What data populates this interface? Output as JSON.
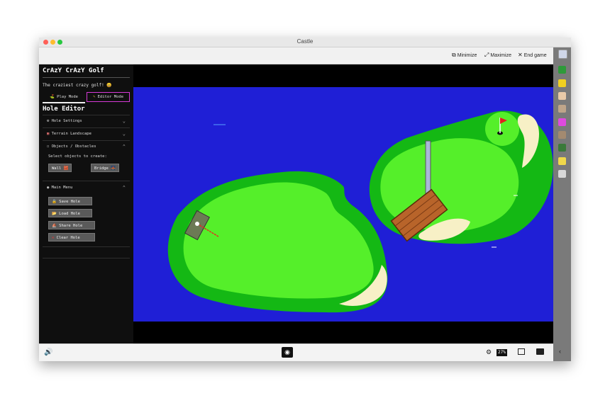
{
  "window": {
    "title": "Castle",
    "toolbar": {
      "minimize": "Minimize",
      "maximize": "Maximize",
      "end_game": "End game"
    }
  },
  "sidebar": {
    "game_title": "CrAzY CrAzY Golf",
    "subtitle": "The craziest crazy golf! 😀",
    "modes": {
      "play": "Play Mode",
      "editor": "Editor Mode",
      "active": "editor"
    },
    "section_title": "Hole Editor",
    "sections": [
      {
        "label": "Hole Settings",
        "icon": "gear-icon"
      },
      {
        "label": "Terrain Landscape",
        "icon": "terrain-icon"
      },
      {
        "label": "Objects / Obstacles",
        "icon": "square-icon"
      }
    ],
    "objects_hint": "Select objects to create:",
    "objects": {
      "wall": "Wall 🧱",
      "bridge": "Bridge 🌉"
    },
    "main_menu": {
      "label": "Main Menu",
      "save": "Save Hole",
      "load": "Load Hole",
      "share": "Share Hole",
      "clear": "Clear Hole"
    }
  },
  "status": {
    "cpu_percent": "27%"
  },
  "colors": {
    "water": "#1f1fd6",
    "fairway_dark": "#14b814",
    "fairway_light": "#55ef2a",
    "sand": "#f7f0c6",
    "accent_editor": "#d63ad6"
  }
}
